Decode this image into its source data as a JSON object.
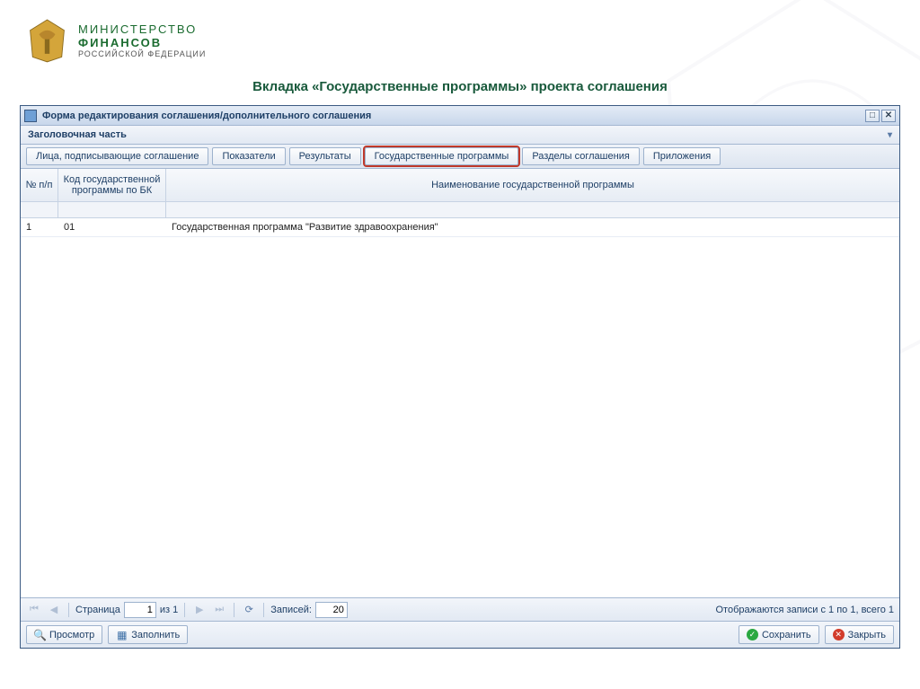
{
  "ministry": {
    "line1": "МИНИСТЕРСТВО",
    "line2": "ФИНАНСОВ",
    "line3": "РОССИЙСКОЙ ФЕДЕРАЦИИ"
  },
  "slide_title": "Вкладка «Государственные программы» проекта соглашения",
  "window": {
    "title": "Форма редактирования соглашения/дополнительного соглашения"
  },
  "section": {
    "title": "Заголовочная часть"
  },
  "tabs": {
    "signers": "Лица, подписывающие соглашение",
    "indicators": "Показатели",
    "results": "Результаты",
    "programs": "Государственные программы",
    "sections": "Разделы соглашения",
    "attachments": "Приложения"
  },
  "columns": {
    "num": "№ п/п",
    "code": "Код государственной программы по БК",
    "name": "Наименование государственной программы"
  },
  "rows": [
    {
      "num": "1",
      "code": "01",
      "name": "Государственная программа \"Развитие здравоохранения\""
    }
  ],
  "paging": {
    "page_label": "Страница",
    "page_value": "1",
    "of_label": "из 1",
    "records_label": "Записей:",
    "records_value": "20",
    "status": "Отображаются записи с 1 по 1, всего 1"
  },
  "toolbar": {
    "view": "Просмотр",
    "fill": "Заполнить",
    "save": "Сохранить",
    "close": "Закрыть"
  }
}
